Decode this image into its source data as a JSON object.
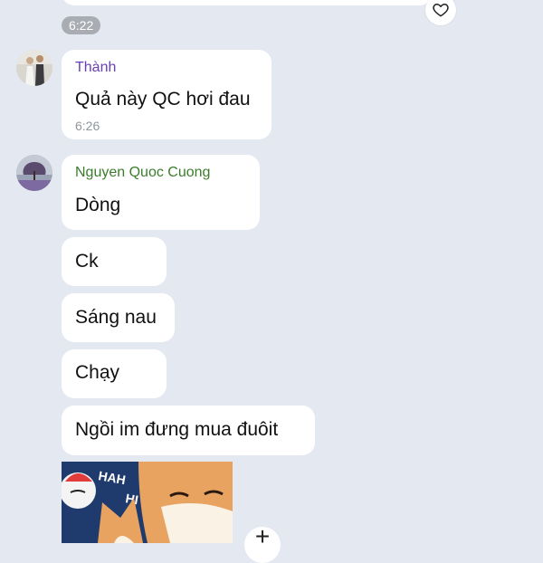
{
  "top": {
    "time": "6:22",
    "heart_icon": "heart-outline-icon"
  },
  "messages": [
    {
      "sender": "Thành",
      "sender_color": "#6a3fb0",
      "text": "Quả này QC hơi đau",
      "time": "6:26"
    },
    {
      "sender": "Nguyen Quoc Cuong",
      "sender_color": "#3a7d2c",
      "text": "Dòng"
    },
    {
      "text": "Ck"
    },
    {
      "text": "Sáng nau"
    },
    {
      "text": "Chạy"
    },
    {
      "text": "Ngồi im đưng mua đuôit"
    }
  ],
  "sticker": {
    "lettering": "HAH HAH HI"
  },
  "colors": {
    "background": "#e3e8f1",
    "bubble": "#ffffff"
  }
}
